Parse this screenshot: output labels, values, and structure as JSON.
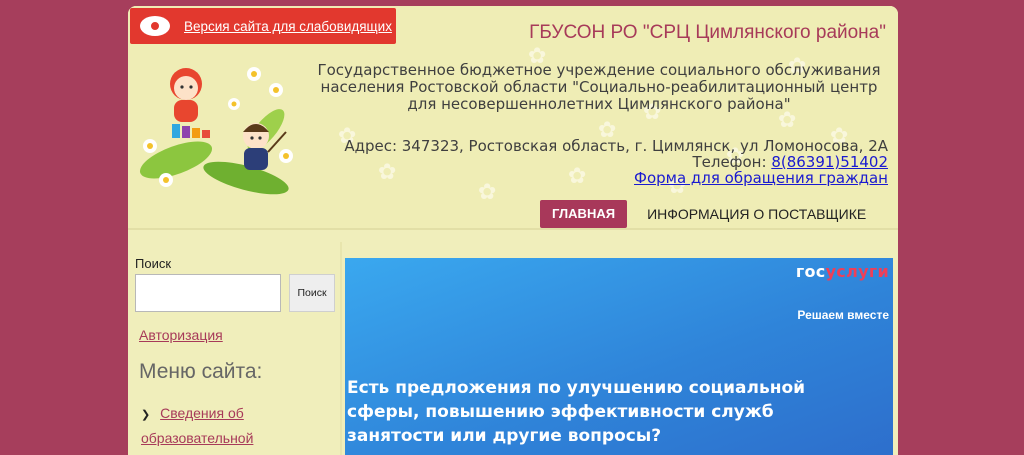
{
  "header": {
    "vision_version": "Версия сайта для слабовидящих",
    "site_title": "ГБУСОН РО \"СРЦ Цимлянского района\"",
    "org_name": "Государственное бюджетное учреждение социального обслуживания населения Ростовской области \"Социально-реабилитационный центр для несовершеннолетних Цимлянского района\"",
    "address": "Адрес: 347323, Ростовская область, г. Цимлянск, ул Ломоносова, 2А",
    "phone_label": "Телефон: ",
    "phone": "8(86391)51402",
    "appeal_form": "Форма для обращения граждан"
  },
  "nav": {
    "items": [
      {
        "label": "ГЛАВНАЯ",
        "active": true
      },
      {
        "label": "ИНФОРМАЦИЯ О ПОСТАВЩИКЕ",
        "active": false
      }
    ]
  },
  "sidebar": {
    "search_label": "Поиск",
    "search_value": "",
    "search_button": "Поиск",
    "auth_link": "Авторизация",
    "menu_title": "Меню сайта:",
    "menu_items": [
      {
        "label": "Сведения об образовательной"
      }
    ]
  },
  "banner": {
    "logo_part1": "гос",
    "logo_part2": "услуги",
    "slogan": "Решаем вместе",
    "text": "Есть предложения по улучшению социальной сферы, повышению эффективности служб занятости или другие вопросы?"
  },
  "colors": {
    "background": "#a63e5c",
    "header_bg": "#efedb5",
    "accent": "#a73a59",
    "vision_button": "#e2382e",
    "link": "#1a1ad0"
  }
}
